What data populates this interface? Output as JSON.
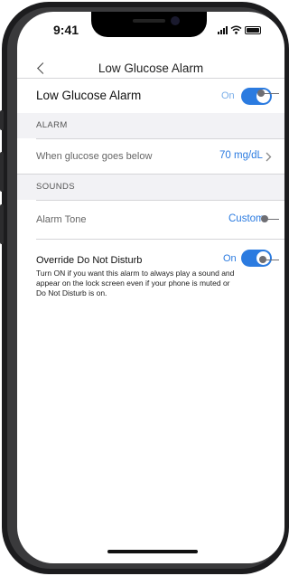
{
  "status_bar": {
    "time": "9:41"
  },
  "nav": {
    "title": "Low Glucose Alarm"
  },
  "main_toggle": {
    "label": "Low Glucose Alarm",
    "state": "On"
  },
  "sections": {
    "alarm": "ALARM",
    "sounds": "SOUNDS"
  },
  "glucose_row": {
    "label": "When glucose goes below",
    "value": "70 mg/dL"
  },
  "tone_row": {
    "label": "Alarm Tone",
    "value": "Custom"
  },
  "dnd": {
    "label": "Override Do Not Disturb",
    "state": "On",
    "description": "Turn ON if you want this alarm to always play a sound and appear on the lock screen even if your phone is muted or Do Not Disturb is on."
  },
  "colors": {
    "accent": "#2b7be0",
    "section_bg": "#f2f2f5",
    "frame": "#1c1c1e"
  }
}
